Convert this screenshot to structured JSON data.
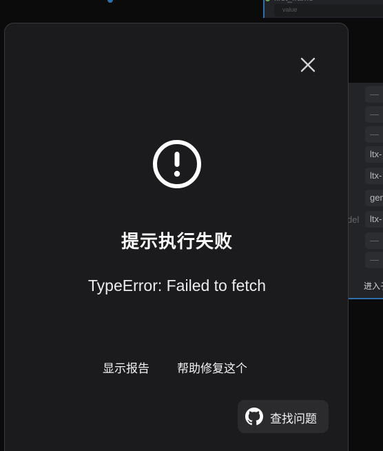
{
  "background": {
    "node_title": "first_frame",
    "node_value_label": "value",
    "panel_rows": [
      "—",
      "—",
      "—",
      "ltx-",
      "ltx-",
      "gen",
      "ltx-",
      "—",
      "—"
    ],
    "model_label_fragment": "del",
    "enter_button_fragment": "进入子"
  },
  "dialog": {
    "title": "提示执行失败",
    "message": "TypeError: Failed to fetch",
    "show_report_label": "显示报告",
    "help_fix_label": "帮助修复这个",
    "find_issues_label": "查找问题",
    "icons": {
      "close": "close-icon",
      "alert": "exclamation-circle-icon",
      "github": "github-icon"
    }
  },
  "colors": {
    "dialog_bg": "#1b1b1d",
    "button_bg": "#2b2b2e",
    "accent_wire": "#2f6fa8",
    "text": "#ffffff"
  }
}
